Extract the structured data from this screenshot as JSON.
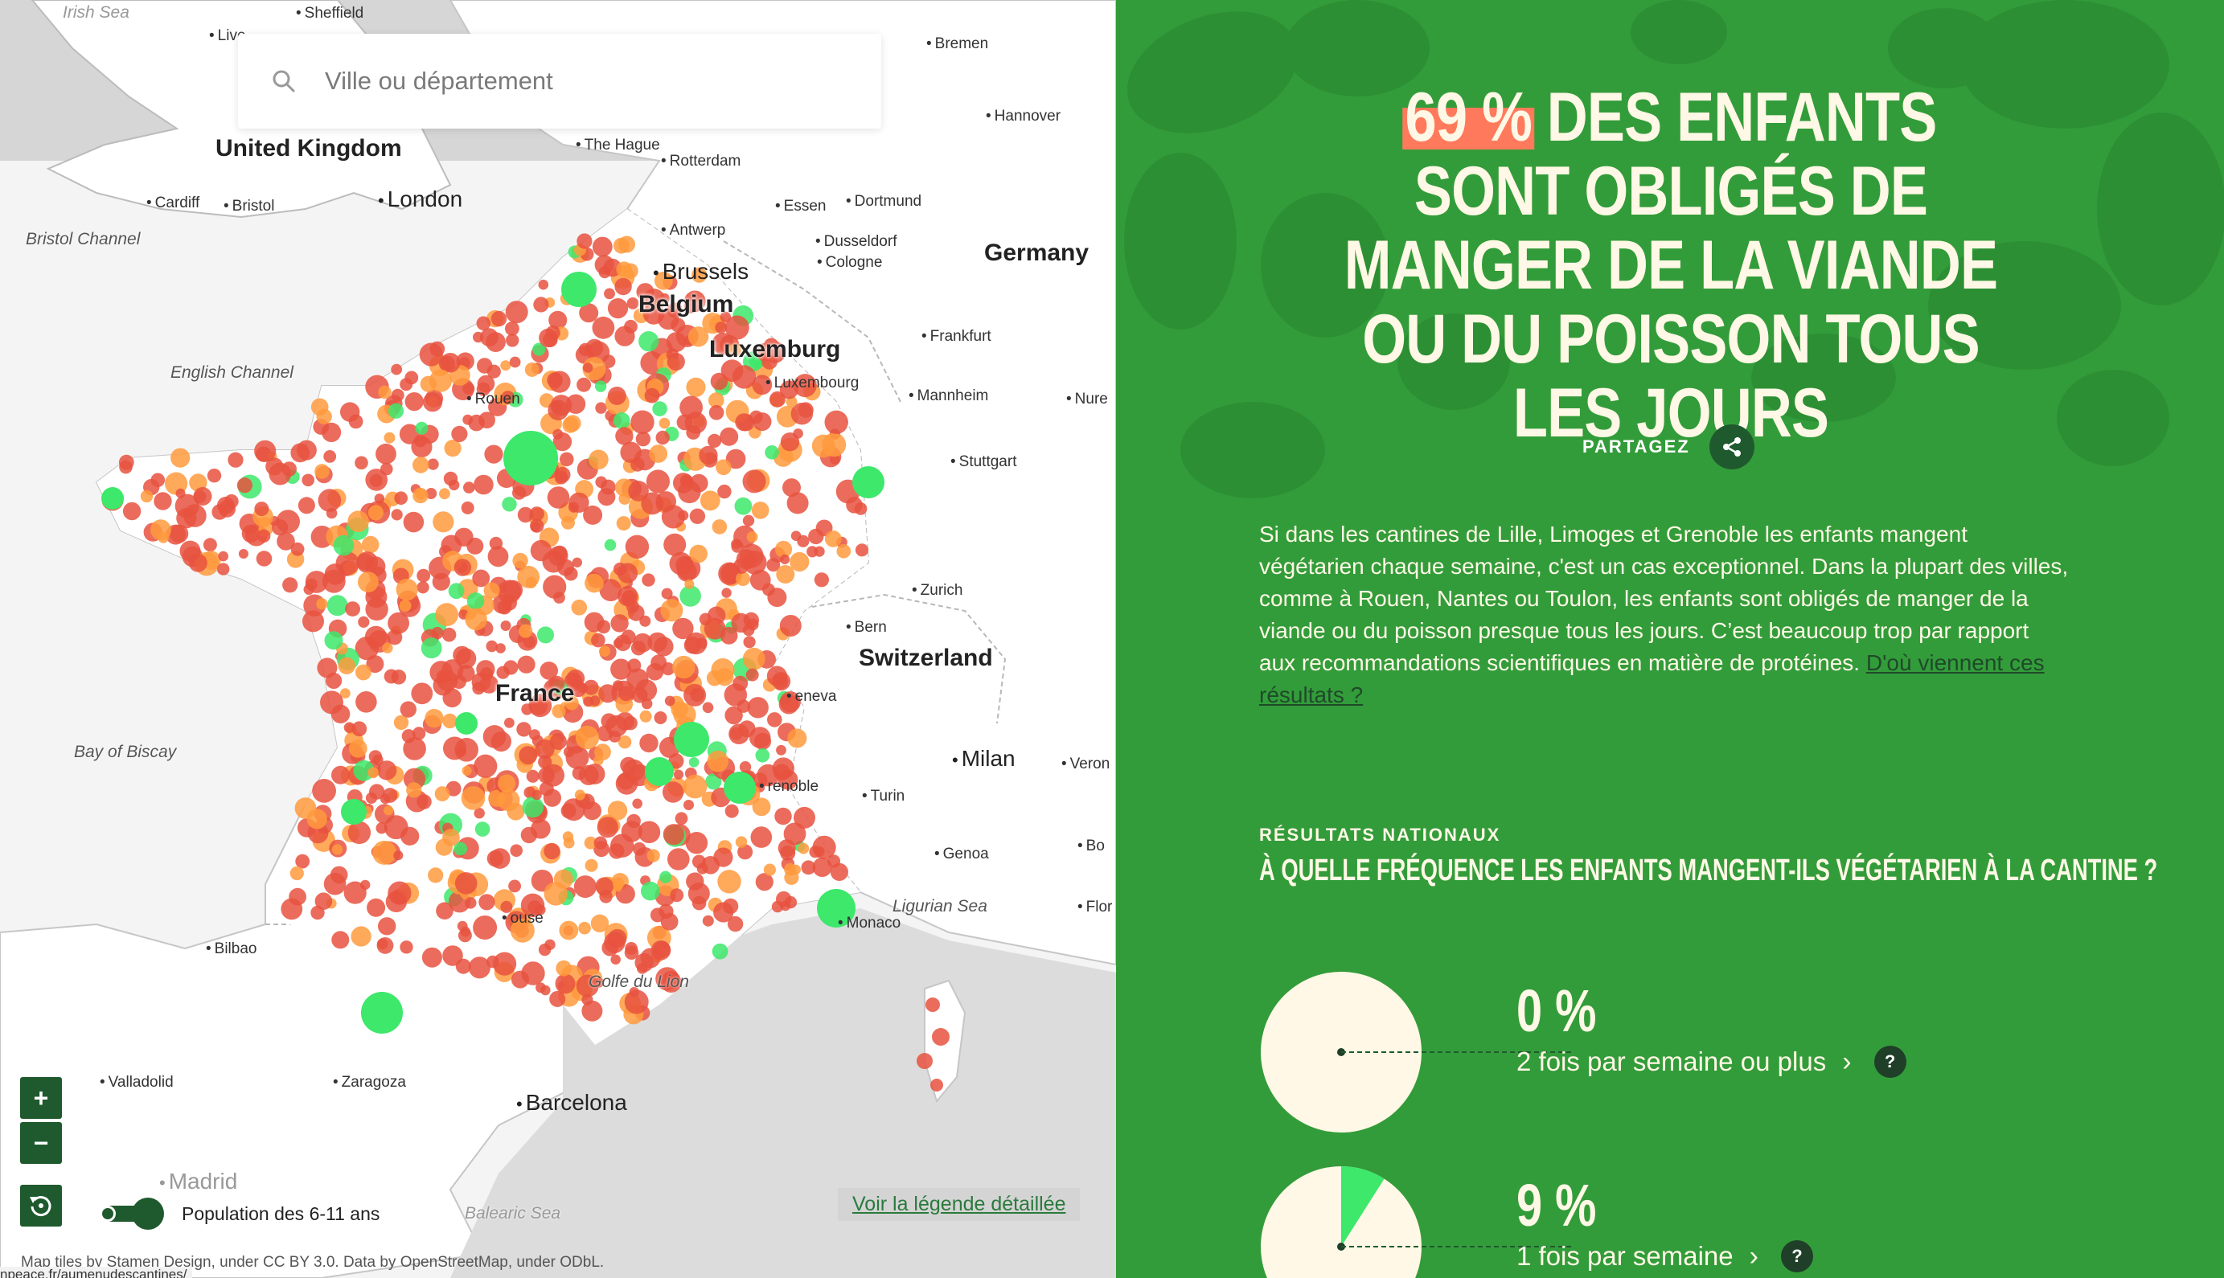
{
  "map": {
    "search": {
      "placeholder": "Ville ou département"
    },
    "labels": {
      "irish_sea": "Irish Sea",
      "sheffield": "Sheffield",
      "liverpool": "Live",
      "bremen": "Bremen",
      "hannover": "Hannover",
      "united_kingdom": "United Kingdom",
      "the_hague": "The Hague",
      "rotterdam": "Rotterdam",
      "cardiff": "Cardiff",
      "bristol": "Bristol",
      "london": "London",
      "bristol_channel": "Bristol Channel",
      "essen": "Essen",
      "dortmund": "Dortmund",
      "antwerp": "Antwerp",
      "dusseldorf": "Dusseldorf",
      "cologne": "Cologne",
      "brussels": "Brussels",
      "germany": "Germany",
      "belgium": "Belgium",
      "frankfurt": "Frankfurt",
      "luxemburg_country": "Luxemburg",
      "luxembourg_city": "Luxembourg",
      "english_channel": "English Channel",
      "rouen": "Rouen",
      "mannheim": "Mannheim",
      "nurnberg": "Nure",
      "stuttgart": "Stuttgart",
      "zurich": "Zurich",
      "bern": "Bern",
      "switzerland": "Switzerland",
      "france": "France",
      "geneva": "eneva",
      "bay_of_biscay": "Bay of Biscay",
      "milan": "Milan",
      "verona": "Veron",
      "grenoble": "renoble",
      "turin": "Turin",
      "genoa": "Genoa",
      "bologna": "Bo",
      "ligurian_sea": "Ligurian Sea",
      "florence": "Flor",
      "monaco": "Monaco",
      "bilbao": "Bilbao",
      "golfe_du_lion": "Golfe du Lion",
      "valladolid": "Valladolid",
      "zaragoza": "Zaragoza",
      "barcelona": "Barcelona",
      "madrid": "Madrid",
      "balearic_sea": "Balearic Sea",
      "toulouse": "ouse"
    },
    "controls": {
      "zoom_in": "+",
      "zoom_out": "−",
      "reset_icon": "reset-view-icon",
      "population_label": "Population des 6-11 ans",
      "legend_link": "Voir la légende détaillée"
    },
    "attribution": "Map tiles by Stamen Design, under CC BY 3.0. Data by OpenStreetMap, under ODbL.",
    "url_fragment": "npeace.fr/aumenudescantines/",
    "colors": {
      "red": "#e8523f",
      "orange": "#ff9a3d",
      "green": "#3de86b",
      "dark_green": "#1f5a2e"
    }
  },
  "panel": {
    "headline_pct": "69 %",
    "headline_rest": " DES ENFANTS SONT OBLIGÉS DE MANGER DE LA VIANDE OU DU POISSON TOUS LES JOURS",
    "share_label": "PARTAGEZ",
    "share_icon": "share-icon",
    "intro": "Si dans les cantines de Lille, Limoges et Grenoble les enfants mangent végétarien chaque semaine, c'est un cas exceptionnel. Dans la plupart des villes, comme à Rouen, Nantes ou Toulon, les enfants sont obligés de manger de la viande ou du poisson presque tous les jours. C’est beaucoup trop par rapport aux recommandations scientifiques en matière de protéines.",
    "intro_link": "D'où viennent ces résultats ?",
    "section_kicker": "RÉSULTATS NATIONAUX",
    "section_question": "À QUELLE FRÉQUENCE LES ENFANTS MANGENT-ILS VÉGÉTARIEN À LA CANTINE ?",
    "results": [
      {
        "percent": "0 %",
        "fraction": 0.0,
        "label": "2 fois par semaine ou plus",
        "chevron": "›",
        "help": "?"
      },
      {
        "percent": "9 %",
        "fraction": 0.09,
        "label": "1 fois par semaine",
        "chevron": "›",
        "help": "?"
      }
    ],
    "colors": {
      "background": "#339c3a",
      "cream": "#fff8e6",
      "highlight": "#ff7a5c",
      "slice": "#3de86b"
    }
  }
}
